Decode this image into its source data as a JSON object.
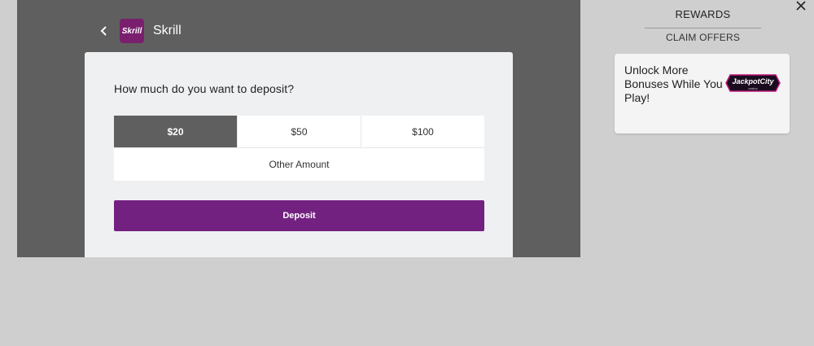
{
  "deposit": {
    "back_icon": "chevron-left-icon",
    "logo_text": "Skrill",
    "title": "Skrill",
    "question": "How much do you want to deposit?",
    "amounts": [
      {
        "label": "$20",
        "selected": true
      },
      {
        "label": "$50",
        "selected": false
      },
      {
        "label": "$100",
        "selected": false
      }
    ],
    "other_amount": "Other Amount",
    "deposit_label": "Deposit",
    "colors": {
      "overlay": "#5f5f5f",
      "card": "#eff0f2",
      "brand": "#722180",
      "selected": "#5f5f5f"
    }
  },
  "rewards": {
    "close_icon": "close-icon",
    "title": "REWARDS",
    "claim_offers": "CLAIM OFFERS",
    "offer": {
      "text": "Unlock More Bonuses While You Play!",
      "badge_text": "JackpotCity",
      "badge_subtext": "casino"
    }
  }
}
